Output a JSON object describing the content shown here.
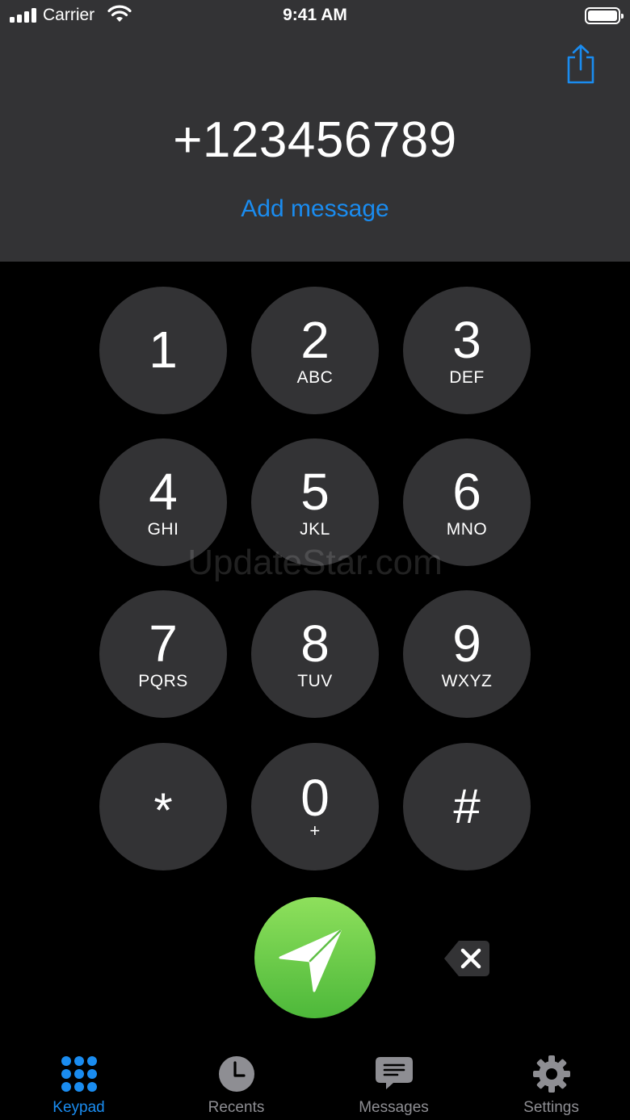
{
  "status_bar": {
    "carrier": "Carrier",
    "time": "9:41 AM",
    "icons": [
      "signal-icon",
      "wifi-icon",
      "battery-icon"
    ]
  },
  "header": {
    "phone_number": "+123456789",
    "add_message_label": "Add message",
    "share_icon": "share-icon"
  },
  "keypad": {
    "keys": [
      {
        "digit": "1",
        "letters": ""
      },
      {
        "digit": "2",
        "letters": "ABC"
      },
      {
        "digit": "3",
        "letters": "DEF"
      },
      {
        "digit": "4",
        "letters": "GHI"
      },
      {
        "digit": "5",
        "letters": "JKL"
      },
      {
        "digit": "6",
        "letters": "MNO"
      },
      {
        "digit": "7",
        "letters": "PQRS"
      },
      {
        "digit": "8",
        "letters": "TUV"
      },
      {
        "digit": "9",
        "letters": "WXYZ"
      },
      {
        "digit": "*",
        "letters": ""
      },
      {
        "digit": "0",
        "letters": "+"
      },
      {
        "digit": "#",
        "letters": ""
      }
    ]
  },
  "watermark": "UpdateStar.com",
  "actions": {
    "send_icon": "send-icon",
    "delete_icon": "backspace-icon"
  },
  "tab_bar": {
    "tabs": [
      {
        "label": "Keypad",
        "icon": "keypad-grid-icon",
        "active": true
      },
      {
        "label": "Recents",
        "icon": "clock-icon",
        "active": false
      },
      {
        "label": "Messages",
        "icon": "message-bubble-icon",
        "active": false
      },
      {
        "label": "Settings",
        "icon": "gear-icon",
        "active": false
      }
    ]
  },
  "colors": {
    "accent": "#1a8cf0",
    "key_background": "#333335",
    "send_green": "#5cc845",
    "inactive_tab": "#8e8e93"
  }
}
